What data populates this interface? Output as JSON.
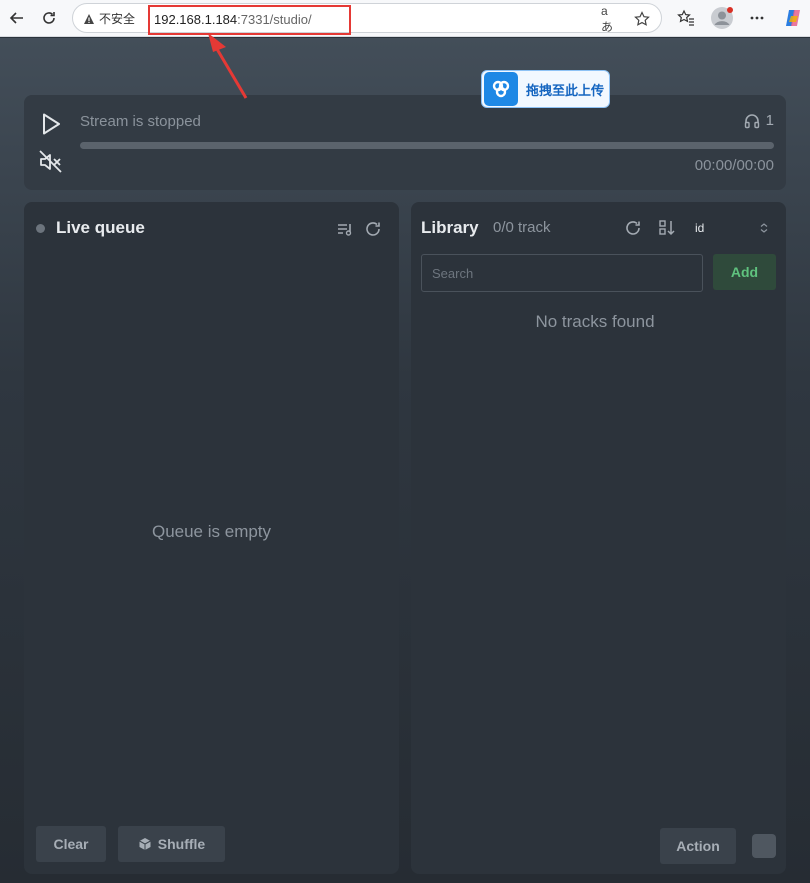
{
  "browser": {
    "security_label": "不安全",
    "url_host": "192.168.1.184",
    "url_rest": ":7331/studio/"
  },
  "overlay": {
    "upload_label": "拖拽至此上传"
  },
  "player": {
    "status": "Stream is stopped",
    "listeners": "1",
    "time": "00:00/00:00"
  },
  "queue": {
    "title": "Live queue",
    "empty_text": "Queue is empty",
    "clear_label": "Clear",
    "shuffle_label": "Shuffle"
  },
  "library": {
    "title": "Library",
    "count": "0/0 track",
    "sort_value": "id",
    "search_placeholder": "Search",
    "add_label": "Add",
    "empty_text": "No tracks found",
    "action_label": "Action"
  },
  "colors": {
    "accent_green": "#5fc27e",
    "annotation_red": "#e53935",
    "panel_bg": "#2c333b"
  }
}
